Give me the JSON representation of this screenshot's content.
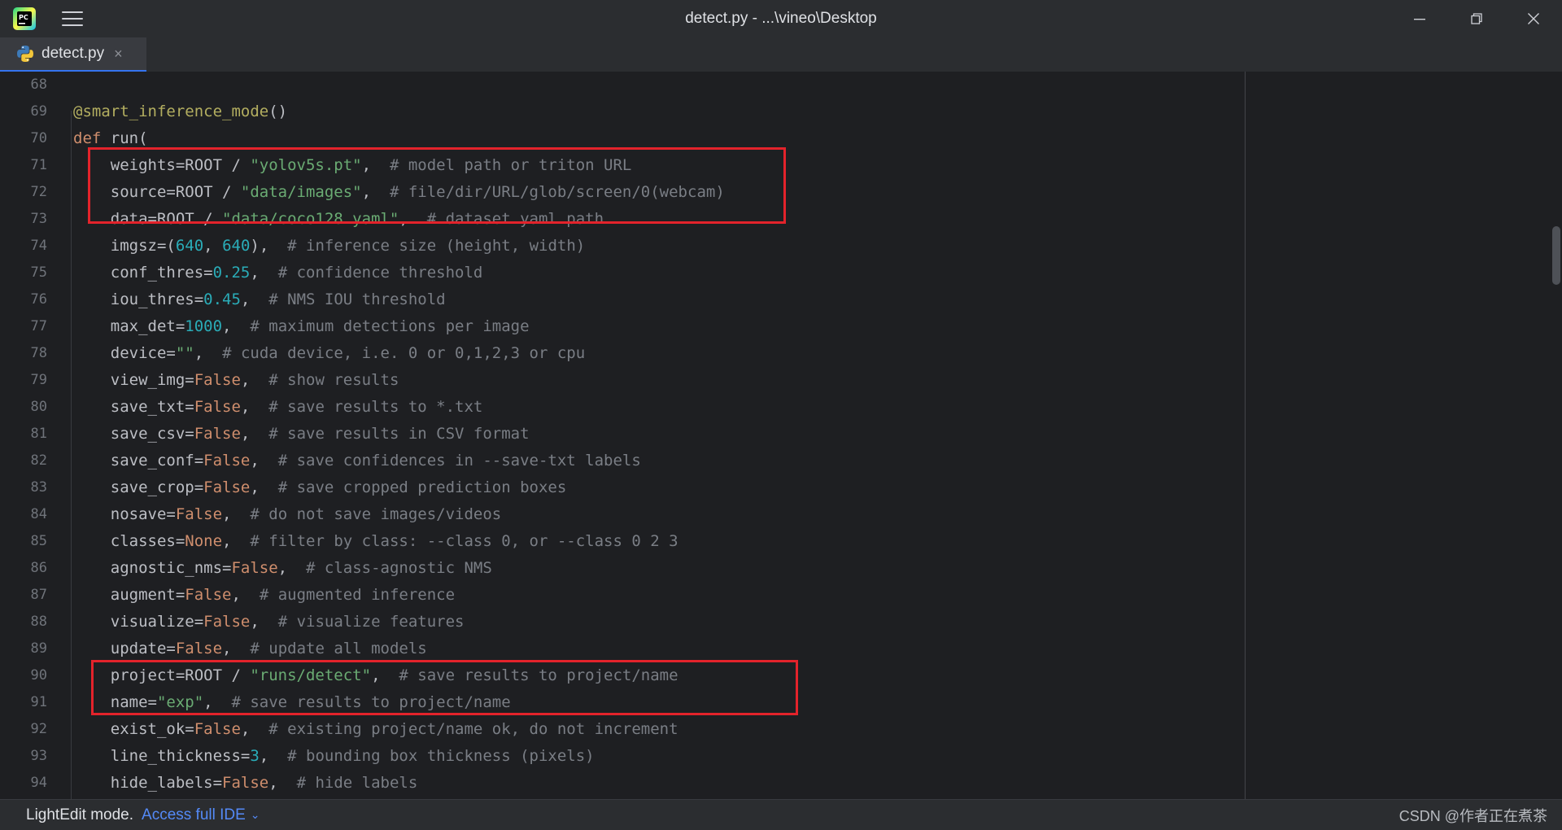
{
  "window": {
    "title": "detect.py - ...\\vineo\\Desktop",
    "icons": [
      "pycharm-logo",
      "hamburger-menu-icon",
      "minimize-icon",
      "restore-icon",
      "close-icon"
    ]
  },
  "tabs": [
    {
      "label": "detect.py",
      "icon": "python-file-icon",
      "close": "×",
      "active": true
    }
  ],
  "editor": {
    "line_numbers": [
      "68",
      "69",
      "70",
      "71",
      "72",
      "73",
      "74",
      "75",
      "76",
      "77",
      "78",
      "79",
      "80",
      "81",
      "82",
      "83",
      "84",
      "85",
      "86",
      "87",
      "88",
      "89",
      "90",
      "91",
      "92",
      "93",
      "94"
    ],
    "highlighted_lines": [
      [
        "71",
        "73"
      ],
      [
        "90",
        "91"
      ]
    ],
    "highlight_color": "#e3232b",
    "lines": [
      [],
      [
        {
          "t": "@smart_inference_mode",
          "c": "dec"
        },
        {
          "t": "()",
          "c": ""
        }
      ],
      [
        {
          "t": "def ",
          "c": "kw"
        },
        {
          "t": "run(",
          "c": ""
        }
      ],
      [
        {
          "t": "    weights=ROOT / ",
          "c": ""
        },
        {
          "t": "\"yolov5s.pt\"",
          "c": "str"
        },
        {
          "t": ",  ",
          "c": ""
        },
        {
          "t": "# model path or triton URL",
          "c": "cm"
        }
      ],
      [
        {
          "t": "    source=ROOT / ",
          "c": ""
        },
        {
          "t": "\"data/images\"",
          "c": "str"
        },
        {
          "t": ",  ",
          "c": ""
        },
        {
          "t": "# file/dir/URL/glob/screen/0(webcam)",
          "c": "cm"
        }
      ],
      [
        {
          "t": "    data=ROOT / ",
          "c": ""
        },
        {
          "t": "\"data/coco128.yaml\"",
          "c": "str"
        },
        {
          "t": ",  ",
          "c": ""
        },
        {
          "t": "# dataset.yaml path",
          "c": "cm"
        }
      ],
      [
        {
          "t": "    imgsz=(",
          "c": ""
        },
        {
          "t": "640",
          "c": "num"
        },
        {
          "t": ", ",
          "c": ""
        },
        {
          "t": "640",
          "c": "num"
        },
        {
          "t": "),  ",
          "c": ""
        },
        {
          "t": "# inference size (height, width)",
          "c": "cm"
        }
      ],
      [
        {
          "t": "    conf_thres=",
          "c": ""
        },
        {
          "t": "0.25",
          "c": "num"
        },
        {
          "t": ",  ",
          "c": ""
        },
        {
          "t": "# confidence threshold",
          "c": "cm"
        }
      ],
      [
        {
          "t": "    iou_thres=",
          "c": ""
        },
        {
          "t": "0.45",
          "c": "num"
        },
        {
          "t": ",  ",
          "c": ""
        },
        {
          "t": "# NMS IOU threshold",
          "c": "cm"
        }
      ],
      [
        {
          "t": "    max_det=",
          "c": ""
        },
        {
          "t": "1000",
          "c": "num"
        },
        {
          "t": ",  ",
          "c": ""
        },
        {
          "t": "# maximum detections per image",
          "c": "cm"
        }
      ],
      [
        {
          "t": "    device=",
          "c": ""
        },
        {
          "t": "\"\"",
          "c": "str"
        },
        {
          "t": ",  ",
          "c": ""
        },
        {
          "t": "# cuda device, i.e. 0 or 0,1,2,3 or cpu",
          "c": "cm"
        }
      ],
      [
        {
          "t": "    view_img=",
          "c": ""
        },
        {
          "t": "False",
          "c": "kw"
        },
        {
          "t": ",  ",
          "c": ""
        },
        {
          "t": "# show results",
          "c": "cm"
        }
      ],
      [
        {
          "t": "    save_txt=",
          "c": ""
        },
        {
          "t": "False",
          "c": "kw"
        },
        {
          "t": ",  ",
          "c": ""
        },
        {
          "t": "# save results to *.txt",
          "c": "cm"
        }
      ],
      [
        {
          "t": "    save_csv=",
          "c": ""
        },
        {
          "t": "False",
          "c": "kw"
        },
        {
          "t": ",  ",
          "c": ""
        },
        {
          "t": "# save results in CSV format",
          "c": "cm"
        }
      ],
      [
        {
          "t": "    save_conf=",
          "c": ""
        },
        {
          "t": "False",
          "c": "kw"
        },
        {
          "t": ",  ",
          "c": ""
        },
        {
          "t": "# save confidences in --save-txt labels",
          "c": "cm"
        }
      ],
      [
        {
          "t": "    save_crop=",
          "c": ""
        },
        {
          "t": "False",
          "c": "kw"
        },
        {
          "t": ",  ",
          "c": ""
        },
        {
          "t": "# save cropped prediction boxes",
          "c": "cm"
        }
      ],
      [
        {
          "t": "    nosave=",
          "c": ""
        },
        {
          "t": "False",
          "c": "kw"
        },
        {
          "t": ",  ",
          "c": ""
        },
        {
          "t": "# do not save images/videos",
          "c": "cm"
        }
      ],
      [
        {
          "t": "    classes=",
          "c": ""
        },
        {
          "t": "None",
          "c": "kw"
        },
        {
          "t": ",  ",
          "c": ""
        },
        {
          "t": "# filter by class: --class 0, or --class 0 2 3",
          "c": "cm"
        }
      ],
      [
        {
          "t": "    agnostic_nms=",
          "c": ""
        },
        {
          "t": "False",
          "c": "kw"
        },
        {
          "t": ",  ",
          "c": ""
        },
        {
          "t": "# class-agnostic NMS",
          "c": "cm"
        }
      ],
      [
        {
          "t": "    augment=",
          "c": ""
        },
        {
          "t": "False",
          "c": "kw"
        },
        {
          "t": ",  ",
          "c": ""
        },
        {
          "t": "# augmented inference",
          "c": "cm"
        }
      ],
      [
        {
          "t": "    visualize=",
          "c": ""
        },
        {
          "t": "False",
          "c": "kw"
        },
        {
          "t": ",  ",
          "c": ""
        },
        {
          "t": "# visualize features",
          "c": "cm"
        }
      ],
      [
        {
          "t": "    update=",
          "c": ""
        },
        {
          "t": "False",
          "c": "kw"
        },
        {
          "t": ",  ",
          "c": ""
        },
        {
          "t": "# update all models",
          "c": "cm"
        }
      ],
      [
        {
          "t": "    project=ROOT / ",
          "c": ""
        },
        {
          "t": "\"runs/detect\"",
          "c": "str"
        },
        {
          "t": ",  ",
          "c": ""
        },
        {
          "t": "# save results to project/name",
          "c": "cm"
        }
      ],
      [
        {
          "t": "    name=",
          "c": ""
        },
        {
          "t": "\"exp\"",
          "c": "str"
        },
        {
          "t": ",  ",
          "c": ""
        },
        {
          "t": "# save results to project/name",
          "c": "cm"
        }
      ],
      [
        {
          "t": "    exist_ok=",
          "c": ""
        },
        {
          "t": "False",
          "c": "kw"
        },
        {
          "t": ",  ",
          "c": ""
        },
        {
          "t": "# existing project/name ok, do not increment",
          "c": "cm"
        }
      ],
      [
        {
          "t": "    line_thickness=",
          "c": ""
        },
        {
          "t": "3",
          "c": "num"
        },
        {
          "t": ",  ",
          "c": ""
        },
        {
          "t": "# bounding box thickness (pixels)",
          "c": "cm"
        }
      ],
      [
        {
          "t": "    hide_labels=",
          "c": ""
        },
        {
          "t": "False",
          "c": "kw"
        },
        {
          "t": ",  ",
          "c": ""
        },
        {
          "t": "# hide labels",
          "c": "cm"
        }
      ]
    ]
  },
  "statusbar": {
    "mode": "LightEdit mode.",
    "link": "Access full IDE",
    "chevron": "⌄",
    "watermark": "CSDN @作者正在煮茶"
  },
  "colors": {
    "keyword": "#cf8e6d",
    "string": "#6aab73",
    "number": "#2aacb8",
    "comment": "#7a7e85",
    "decorator": "#b3ae60",
    "link": "#548af7"
  }
}
